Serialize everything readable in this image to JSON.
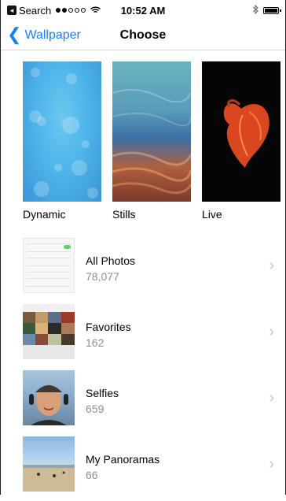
{
  "status_bar": {
    "carrier": "Search",
    "time": "10:52 AM",
    "signal_bars": 2,
    "signal_total": 5
  },
  "nav": {
    "back_label": "Wallpaper",
    "title": "Choose"
  },
  "categories": [
    {
      "label": "Dynamic"
    },
    {
      "label": "Stills"
    },
    {
      "label": "Live"
    }
  ],
  "albums": [
    {
      "title": "All Photos",
      "count": "78,077"
    },
    {
      "title": "Favorites",
      "count": "162"
    },
    {
      "title": "Selfies",
      "count": "659"
    },
    {
      "title": "My Panoramas",
      "count": "66"
    }
  ],
  "colors": {
    "accent": "#1a7ff6",
    "secondary_text": "#8e8e93",
    "chevron": "#c7c7cc"
  }
}
